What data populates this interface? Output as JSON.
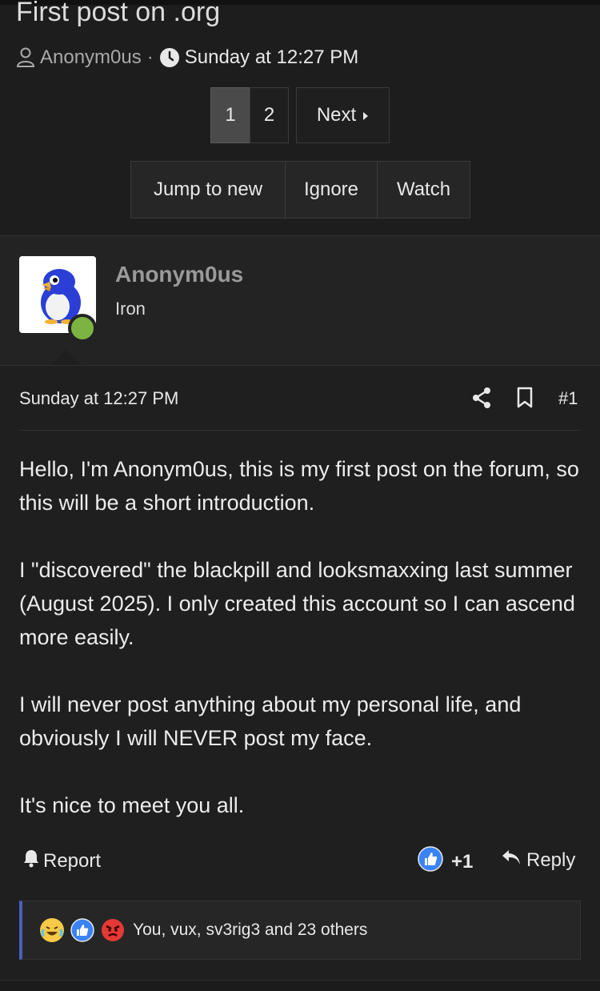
{
  "thread": {
    "title": "First post on .org",
    "author": "Anonym0us",
    "separator": "·",
    "date": "Sunday at 12:27 PM"
  },
  "pagination": {
    "pages": [
      "1",
      "2"
    ],
    "current": "1",
    "next_label": "Next"
  },
  "actions": {
    "jump_to_new": "Jump to new",
    "ignore": "Ignore",
    "watch": "Watch"
  },
  "user": {
    "name": "Anonym0us",
    "title": "Iron",
    "online_color": "#7cb342"
  },
  "post": {
    "date": "Sunday at 12:27 PM",
    "number": "#1",
    "paragraphs": [
      "Hello, I'm Anonym0us, this is my first post on the forum, so this will be a short introduction.",
      "I \"discovered\" the blackpill and looksmaxxing last summer (August 2025). I only created this account so I can ascend more easily.",
      "I will never post anything about my personal life, and obviously I will NEVER post my face.",
      "It's nice to meet you all."
    ],
    "report_label": "Report",
    "reaction_count": "+1",
    "reply_label": "Reply"
  },
  "reactions": {
    "icons": [
      "laughing-crying-emoji-icon",
      "thumbs-up-icon",
      "angry-face-icon"
    ],
    "summary": "You, vux, sv3rig3 and 23 others"
  },
  "colors": {
    "accent": "#4a5fc1",
    "like_blue": "#3b82f6"
  }
}
